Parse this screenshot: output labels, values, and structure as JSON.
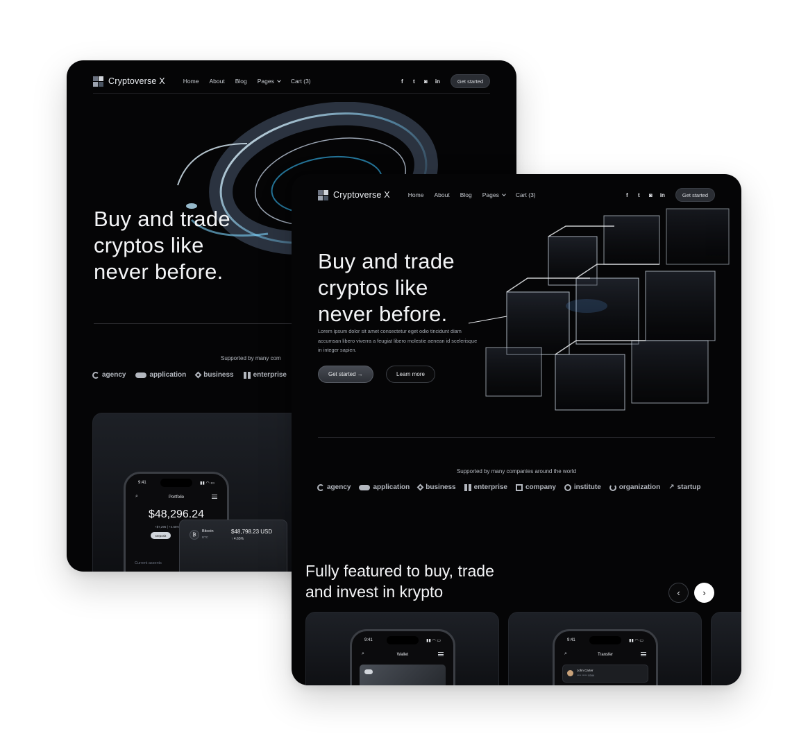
{
  "nav": {
    "logo": "Cryptoverse X",
    "links": [
      "Home",
      "About",
      "Blog",
      "Pages",
      "Cart (3)"
    ],
    "social": [
      "f",
      "t",
      "ig",
      "in"
    ],
    "cta": "Get started"
  },
  "hero": {
    "line1": "Buy and trade",
    "line2": "cryptos like",
    "line3": "never before.",
    "description": "Lorem ipsum dolor sit amet consectetur eget odio tincidunt diam accumsan libero viverra a feugiat libero molestie aenean id scelerisque in integer sapien.",
    "primary_button": "Get started →",
    "secondary_button": "Learn more"
  },
  "supported": {
    "label_full": "Supported by many companies around the world",
    "label_cropped": "Supported by many com",
    "brands": [
      "agency",
      "application",
      "business",
      "enterprise",
      "company",
      "institute",
      "organization",
      "startup"
    ]
  },
  "features": {
    "title_line1": "Fully featured to buy,  trade",
    "title_line2": "and invest in krypto"
  },
  "portfolio_phone": {
    "time": "9:41",
    "title": "Portfolio",
    "balance": "$48,296.24",
    "change": "+$7,296 | +4.65%",
    "deposit": "Deposit",
    "assets_label": "Current assents"
  },
  "bitcoin_card": {
    "name": "Bitcoin",
    "ticker": "BTC",
    "price": "$48,798.23  USD",
    "change": "↑ 4.65%"
  },
  "wallet_phone": {
    "time": "9:41",
    "title": "Wallet"
  },
  "transfer_phone": {
    "time": "9:41",
    "title": "Transfer",
    "contact": "John Carter",
    "card": "**** ***** 0344"
  }
}
